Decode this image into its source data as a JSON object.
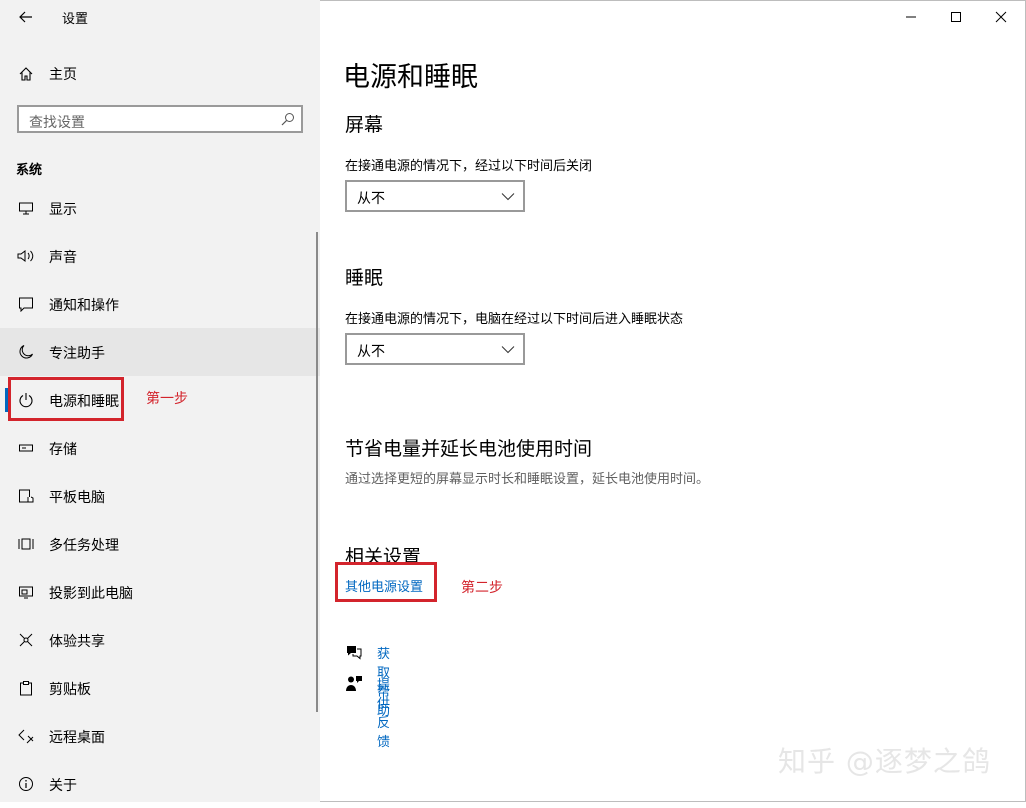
{
  "window": {
    "title": "设置",
    "controls": {
      "minimize": "minimize-icon",
      "maximize": "maximize-icon",
      "close": "close-icon"
    }
  },
  "sidebar": {
    "home_label": "主页",
    "search_placeholder": "查找设置",
    "section_title": "系统",
    "items": [
      {
        "label": "显示",
        "icon": "display-icon"
      },
      {
        "label": "声音",
        "icon": "sound-icon"
      },
      {
        "label": "通知和操作",
        "icon": "notification-icon"
      },
      {
        "label": "专注助手",
        "icon": "moon-icon"
      },
      {
        "label": "电源和睡眠",
        "icon": "power-icon"
      },
      {
        "label": "存储",
        "icon": "storage-icon"
      },
      {
        "label": "平板电脑",
        "icon": "tablet-icon"
      },
      {
        "label": "多任务处理",
        "icon": "multitask-icon"
      },
      {
        "label": "投影到此电脑",
        "icon": "project-icon"
      },
      {
        "label": "体验共享",
        "icon": "share-icon"
      },
      {
        "label": "剪贴板",
        "icon": "clipboard-icon"
      },
      {
        "label": "远程桌面",
        "icon": "remote-desktop-icon"
      },
      {
        "label": "关于",
        "icon": "info-icon"
      }
    ],
    "selected_index": 4,
    "hover_index": 3
  },
  "annotations": {
    "step1": "第一步",
    "step2": "第二步"
  },
  "main": {
    "title": "电源和睡眠",
    "screen": {
      "heading": "屏幕",
      "desc": "在接通电源的情况下，经过以下时间后关闭",
      "value": "从不"
    },
    "sleep": {
      "heading": "睡眠",
      "desc": "在接通电源的情况下，电脑在经过以下时间后进入睡眠状态",
      "value": "从不"
    },
    "battery": {
      "heading": "节省电量并延长电池使用时间",
      "desc": "通过选择更短的屏幕显示时长和睡眠设置，延长电池使用时间。"
    },
    "related": {
      "heading": "相关设置",
      "link": "其他电源设置"
    },
    "help": {
      "get_help": "获取帮助",
      "feedback": "提供反馈"
    }
  },
  "watermark": "知乎 @逐梦之鸽",
  "colors": {
    "accent": "#0067c0",
    "annotation": "#d3242c",
    "sidebar_bg": "#f2f2f2"
  }
}
